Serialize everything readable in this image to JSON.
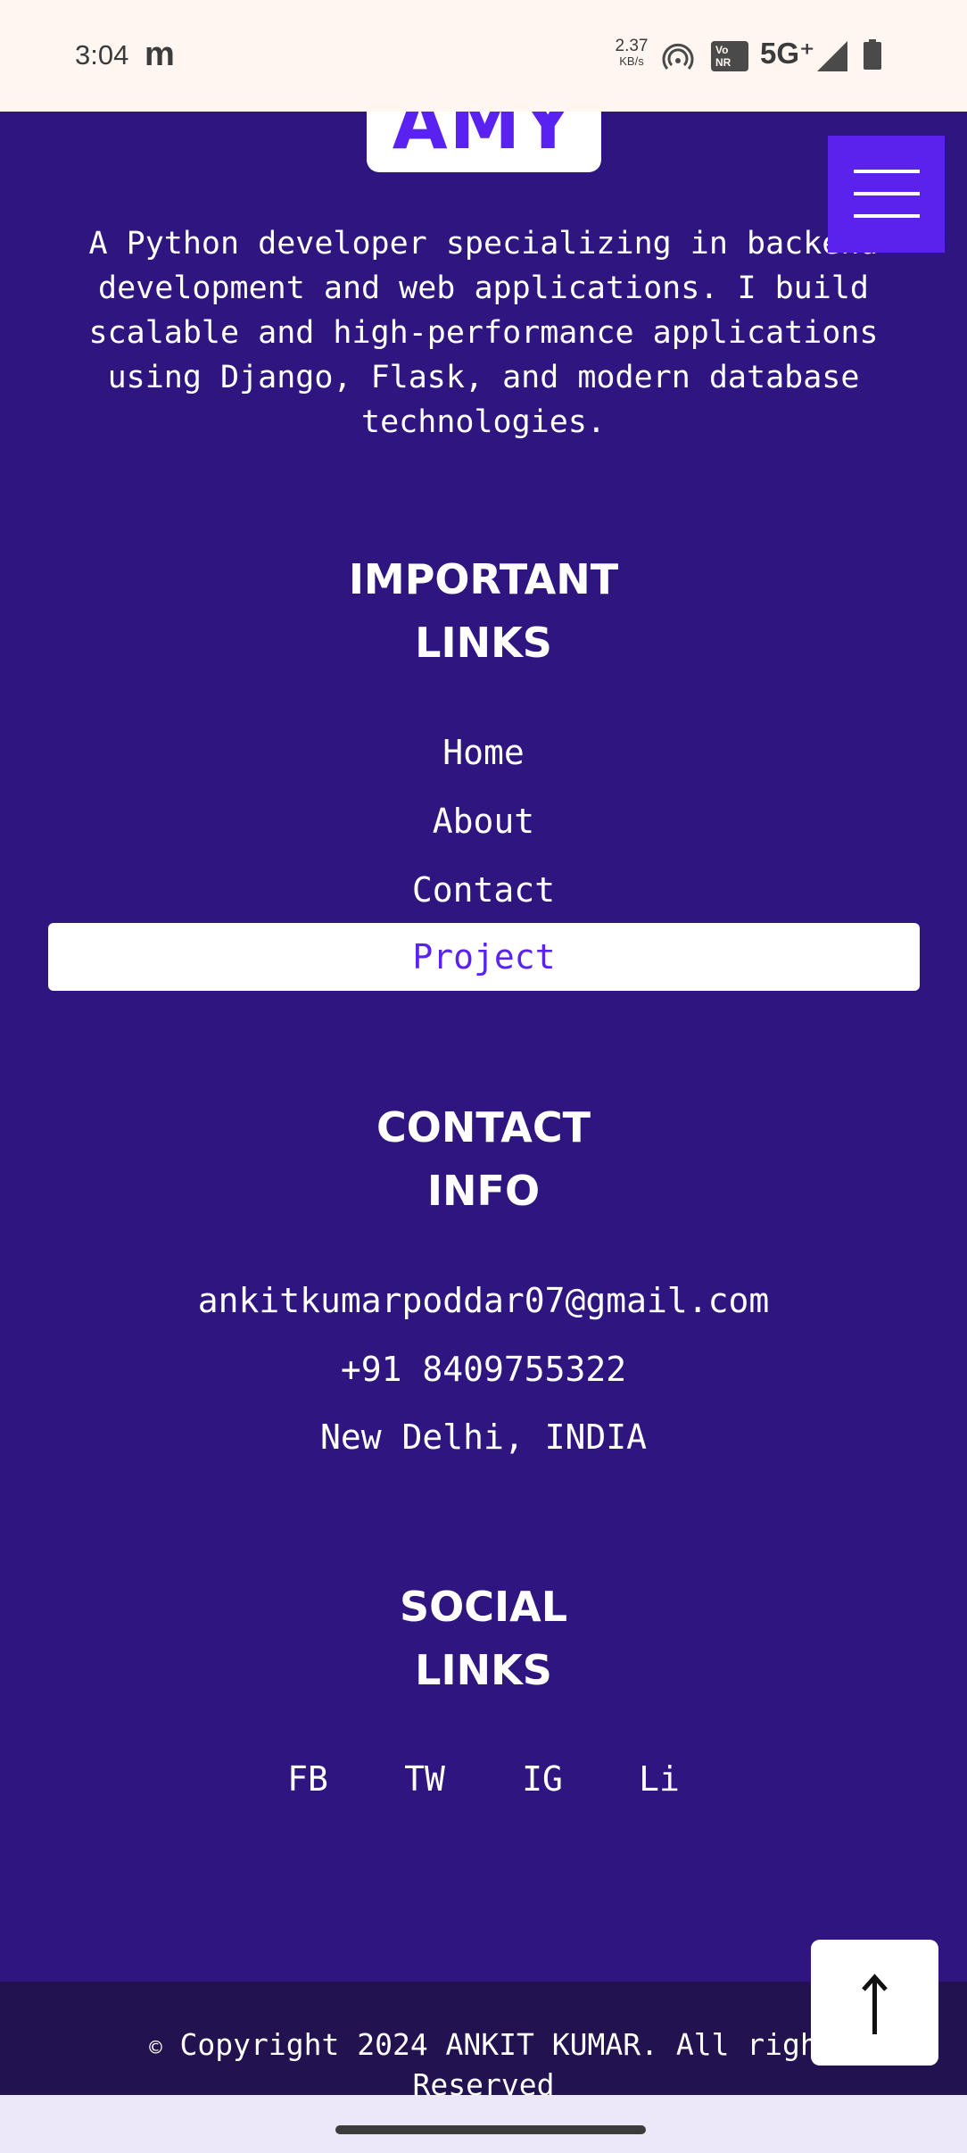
{
  "status_bar": {
    "time": "3:04",
    "app_icon": "m",
    "speed_value": "2.37",
    "speed_unit": "KB/s",
    "vonr": "Vo\nNR",
    "network": "5G⁺",
    "icons": [
      "hotspot-icon",
      "signal-icon",
      "battery-icon"
    ]
  },
  "logo": {
    "text": "AMY"
  },
  "menu": {
    "icon": "hamburger-menu-icon"
  },
  "description": "A Python developer specializing in backend\ndevelopment and web applications. I build\nscalable and high-performance applications\nusing Django, Flask, and modern database\ntechnologies.",
  "important_links": {
    "heading": "IMPORTANT\nLINKS",
    "items": [
      {
        "label": "Home",
        "active": false
      },
      {
        "label": "About",
        "active": false
      },
      {
        "label": "Contact",
        "active": false
      },
      {
        "label": "Project",
        "active": true
      }
    ]
  },
  "contact_info": {
    "heading": "CONTACT\nINFO",
    "email": "ankitkumarpoddar07@gmail.com",
    "phone": "+91 8409755322",
    "location": "New Delhi, INDIA"
  },
  "social_links": {
    "heading": "SOCIAL\nLINKS",
    "items": [
      "FB",
      "TW",
      "IG",
      "Li"
    ]
  },
  "footer": {
    "copyright_symbol": "©",
    "copyright_line1": " Copyright 2024 ANKIT KUMAR. All righ",
    "copyright_line2": "Reserved"
  },
  "scroll_top": {
    "icon": "arrow-up-icon"
  },
  "colors": {
    "page_bg": "#2e1580",
    "accent": "#5b22ee",
    "footer_bg": "#22124f",
    "text": "#ffffff"
  }
}
